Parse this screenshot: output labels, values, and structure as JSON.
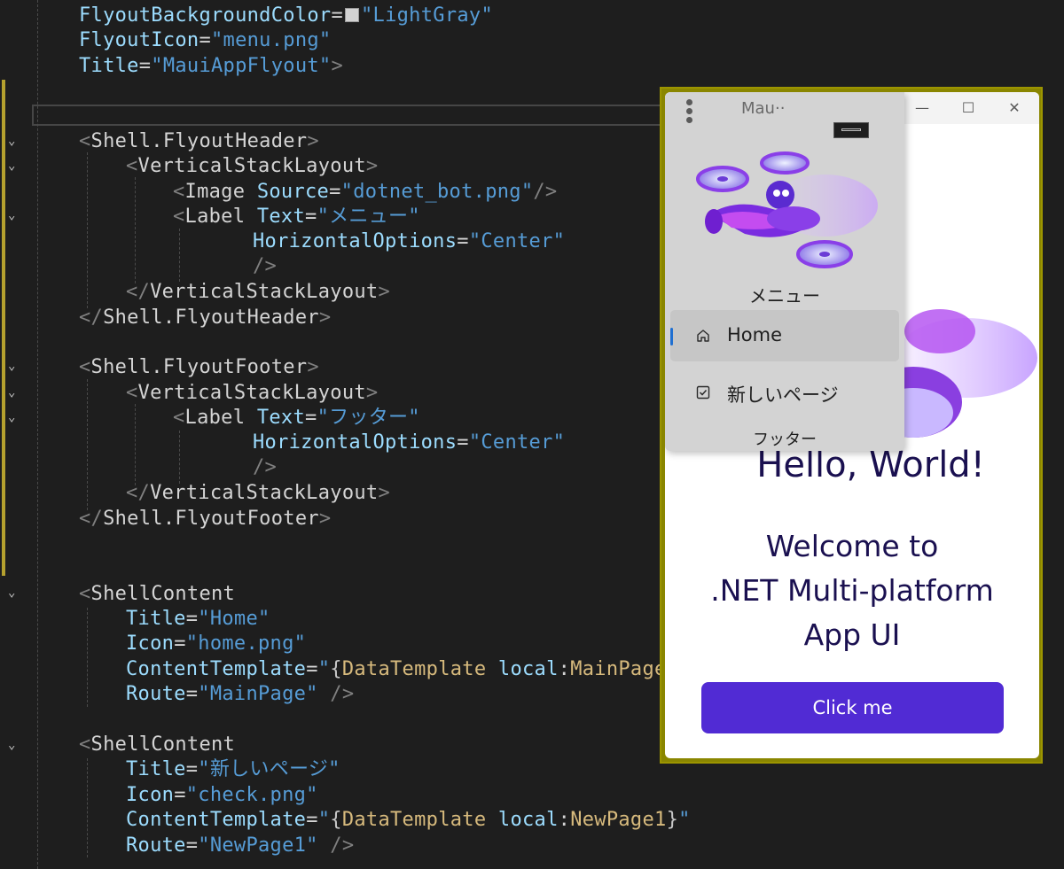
{
  "editor": {
    "lines": [
      [
        {
          "c": "at",
          "t": "FlyoutBackgroundColor"
        },
        {
          "c": "eq",
          "t": "="
        },
        {
          "c": "swatch",
          "t": ""
        },
        {
          "c": "val",
          "t": "\"LightGray\""
        }
      ],
      [
        {
          "c": "at",
          "t": "FlyoutIcon"
        },
        {
          "c": "eq",
          "t": "="
        },
        {
          "c": "val",
          "t": "\"menu.png\""
        }
      ],
      [
        {
          "c": "at",
          "t": "Title"
        },
        {
          "c": "eq",
          "t": "="
        },
        {
          "c": "val",
          "t": "\"MauiAppFlyout\""
        },
        {
          "c": "br",
          "t": ">"
        }
      ],
      [],
      [],
      [
        {
          "c": "br",
          "t": "<"
        },
        {
          "c": "tag",
          "t": "Shell.FlyoutHeader"
        },
        {
          "c": "br",
          "t": ">"
        }
      ],
      [
        {
          "c": "br",
          "t": "<"
        },
        {
          "c": "tag",
          "t": "VerticalStackLayout"
        },
        {
          "c": "br",
          "t": ">"
        }
      ],
      [
        {
          "c": "br",
          "t": "<"
        },
        {
          "c": "tag",
          "t": "Image "
        },
        {
          "c": "at",
          "t": "Source"
        },
        {
          "c": "eq",
          "t": "="
        },
        {
          "c": "val",
          "t": "\"dotnet_bot.png\""
        },
        {
          "c": "br",
          "t": "/>"
        }
      ],
      [
        {
          "c": "br",
          "t": "<"
        },
        {
          "c": "tag",
          "t": "Label "
        },
        {
          "c": "at",
          "t": "Text"
        },
        {
          "c": "eq",
          "t": "="
        },
        {
          "c": "val",
          "t": "\"メニュー\""
        }
      ],
      [
        {
          "c": "at",
          "t": "HorizontalOptions"
        },
        {
          "c": "eq",
          "t": "="
        },
        {
          "c": "val",
          "t": "\"Center\""
        }
      ],
      [
        {
          "c": "br",
          "t": "/>"
        }
      ],
      [
        {
          "c": "br",
          "t": "</"
        },
        {
          "c": "tag",
          "t": "VerticalStackLayout"
        },
        {
          "c": "br",
          "t": ">"
        }
      ],
      [
        {
          "c": "br",
          "t": "</"
        },
        {
          "c": "tag",
          "t": "Shell.FlyoutHeader"
        },
        {
          "c": "br",
          "t": ">"
        }
      ],
      [],
      [
        {
          "c": "br",
          "t": "<"
        },
        {
          "c": "tag",
          "t": "Shell.FlyoutFooter"
        },
        {
          "c": "br",
          "t": ">"
        }
      ],
      [
        {
          "c": "br",
          "t": "<"
        },
        {
          "c": "tag",
          "t": "VerticalStackLayout"
        },
        {
          "c": "br",
          "t": ">"
        }
      ],
      [
        {
          "c": "br",
          "t": "<"
        },
        {
          "c": "tag",
          "t": "Label "
        },
        {
          "c": "at",
          "t": "Text"
        },
        {
          "c": "eq",
          "t": "="
        },
        {
          "c": "val",
          "t": "\"フッター\""
        }
      ],
      [
        {
          "c": "at",
          "t": "HorizontalOptions"
        },
        {
          "c": "eq",
          "t": "="
        },
        {
          "c": "val",
          "t": "\"Center\""
        }
      ],
      [
        {
          "c": "br",
          "t": "/>"
        }
      ],
      [
        {
          "c": "br",
          "t": "</"
        },
        {
          "c": "tag",
          "t": "VerticalStackLayout"
        },
        {
          "c": "br",
          "t": ">"
        }
      ],
      [
        {
          "c": "br",
          "t": "</"
        },
        {
          "c": "tag",
          "t": "Shell.FlyoutFooter"
        },
        {
          "c": "br",
          "t": ">"
        }
      ],
      [],
      [],
      [
        {
          "c": "br",
          "t": "<"
        },
        {
          "c": "tag",
          "t": "ShellContent"
        }
      ],
      [
        {
          "c": "at",
          "t": "Title"
        },
        {
          "c": "eq",
          "t": "="
        },
        {
          "c": "val",
          "t": "\"Home\""
        }
      ],
      [
        {
          "c": "at",
          "t": "Icon"
        },
        {
          "c": "eq",
          "t": "="
        },
        {
          "c": "val",
          "t": "\"home.png\""
        }
      ],
      [
        {
          "c": "at",
          "t": "ContentTemplate"
        },
        {
          "c": "eq",
          "t": "="
        },
        {
          "c": "val",
          "t": "\""
        },
        {
          "c": "ext",
          "t": "{"
        },
        {
          "c": "tmpl",
          "t": "DataTemplate "
        },
        {
          "c": "at",
          "t": "local"
        },
        {
          "c": "eq",
          "t": ":"
        },
        {
          "c": "tmpl",
          "t": "MainPage"
        },
        {
          "c": "ext",
          "t": "}"
        }
      ],
      [
        {
          "c": "at",
          "t": "Route"
        },
        {
          "c": "eq",
          "t": "="
        },
        {
          "c": "val",
          "t": "\"MainPage\""
        },
        {
          "c": "br",
          "t": " />"
        }
      ],
      [],
      [
        {
          "c": "br",
          "t": "<"
        },
        {
          "c": "tag",
          "t": "ShellContent"
        }
      ],
      [
        {
          "c": "at",
          "t": "Title"
        },
        {
          "c": "eq",
          "t": "="
        },
        {
          "c": "val",
          "t": "\"新しいページ\""
        }
      ],
      [
        {
          "c": "at",
          "t": "Icon"
        },
        {
          "c": "eq",
          "t": "="
        },
        {
          "c": "val",
          "t": "\"check.png\""
        }
      ],
      [
        {
          "c": "at",
          "t": "ContentTemplate"
        },
        {
          "c": "eq",
          "t": "="
        },
        {
          "c": "val",
          "t": "\""
        },
        {
          "c": "ext",
          "t": "{"
        },
        {
          "c": "tmpl",
          "t": "DataTemplate "
        },
        {
          "c": "at",
          "t": "local"
        },
        {
          "c": "eq",
          "t": ":"
        },
        {
          "c": "tmpl",
          "t": "NewPage1"
        },
        {
          "c": "ext",
          "t": "}"
        },
        {
          "c": "val",
          "t": "\""
        }
      ],
      [
        {
          "c": "at",
          "t": "Route"
        },
        {
          "c": "eq",
          "t": "="
        },
        {
          "c": "val",
          "t": "\"NewPage1\""
        },
        {
          "c": "br",
          "t": " />"
        }
      ]
    ]
  },
  "app": {
    "window_title": "Mau··",
    "window_buttons": [
      "—",
      "☐",
      "✕"
    ],
    "main": {
      "hello": "Hello, World!",
      "welcome": "Welcome to\n.NET Multi-platform\nApp UI",
      "button_label": "Click me"
    },
    "flyout": {
      "header_label": "メニュー",
      "items": [
        {
          "label": "Home",
          "icon": "home-icon",
          "selected": true
        },
        {
          "label": "新しいページ",
          "icon": "checkbox-icon",
          "selected": false
        }
      ],
      "footer_label": "フッター"
    },
    "colors": {
      "flyout_background": "#d3d3d3",
      "primary_button": "#512bd4",
      "selection_indicator": "#1f6fd1",
      "frame_highlight": "#8a8600"
    }
  }
}
